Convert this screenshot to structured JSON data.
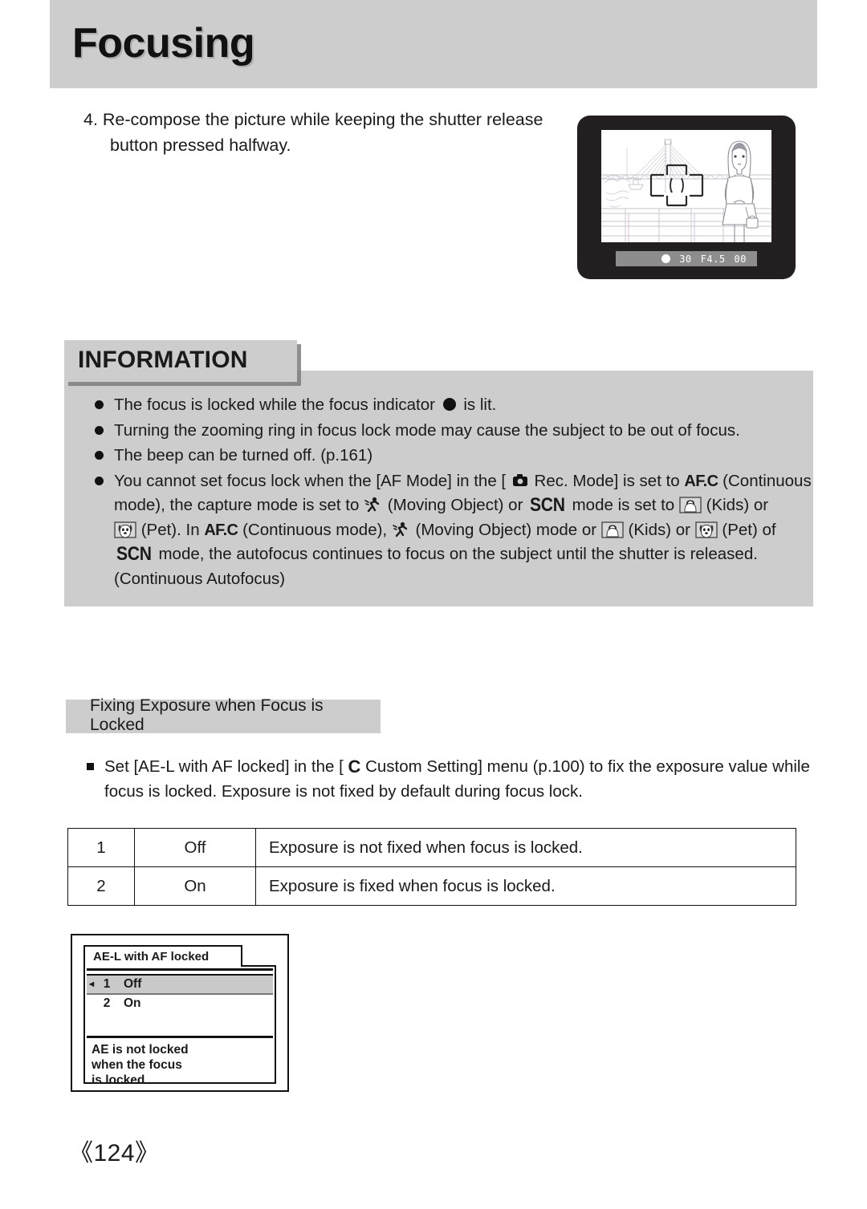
{
  "page": {
    "title": "Focusing",
    "number": "《124》"
  },
  "step": {
    "line1": "4. Re-compose the picture while keeping the shutter release",
    "line2": "button pressed halfway."
  },
  "viewfinder": {
    "alt": "camera-lcd-preview",
    "status": {
      "focus_indicator": "focus-dot",
      "shutter_speed": "30",
      "aperture": "F4.5",
      "exposure_comp": "00"
    }
  },
  "information": {
    "heading": "INFORMATION",
    "items": [
      {
        "id": "focus-locked-indicator",
        "pre": "The focus is locked while the focus indicator",
        "icon": "focus-dot-icon",
        "post": "is lit."
      },
      {
        "id": "zooming-ring",
        "text": "Turning the zooming ring in focus lock mode may cause the subject to be out of focus."
      },
      {
        "id": "beep-off",
        "text": "The beep can be turned off. (p.161)"
      },
      {
        "id": "focus-lock-limits",
        "l1a": "You cannot set focus lock when the [AF Mode] in the [",
        "icon1": "rec-mode-camera-icon",
        "l1b": "Rec. Mode] is set to",
        "icon2": "AF.C",
        "l1c": "(Continuous",
        "l2a": "mode), the capture mode is set to",
        "icon3": "moving-object-icon",
        "l2b": "(Moving Object) or",
        "icon4": "SCN",
        "l2c": "mode is set to",
        "icon5": "kids-icon",
        "l2d": "(Kids) or",
        "l3a": "",
        "icon6": "pet-icon",
        "l3b": "(Pet). In",
        "icon7": "AF.C",
        "l3c": "(Continuous mode),",
        "icon8": "moving-object-icon",
        "l3d": "(Moving Object) mode or",
        "icon9": "kids-icon",
        "l3e": "(Kids) or",
        "icon10": "pet-icon",
        "l3f": "(Pet) of",
        "l4a": "SCN",
        "l4b": "mode, the autofocus continues to focus on the subject until the shutter is released.",
        "l5": "(Continuous Autofocus)"
      }
    ]
  },
  "section": {
    "heading": "Fixing Exposure when Focus is Locked",
    "note": {
      "l1a": "Set [AE-L with AF locked] in the [",
      "icon": "C",
      "l1b": "Custom Setting] menu (p.100) to fix the exposure value while",
      "l2": "focus is locked. Exposure is not fixed by default during focus lock."
    }
  },
  "table": {
    "rows": [
      {
        "num": "1",
        "value": "Off",
        "desc": "Exposure is not fixed when focus is locked."
      },
      {
        "num": "2",
        "value": "On",
        "desc": "Exposure is fixed when focus is locked."
      }
    ]
  },
  "menu_screenshot": {
    "tab_title": "AE-L with AF locked",
    "options": [
      {
        "index": "1",
        "label": "Off",
        "selected": true,
        "marker": "◄"
      },
      {
        "index": "2",
        "label": "On",
        "selected": false,
        "marker": ""
      }
    ],
    "help_l1": "AE is not locked",
    "help_l2": "when the focus",
    "help_l3": "is locked"
  },
  "colors": {
    "panel_gray": "#cdcdcd",
    "lcd_body": "#231f20",
    "status_bar": "#8d8d8d",
    "menu_selected": "#c9c9c9"
  }
}
